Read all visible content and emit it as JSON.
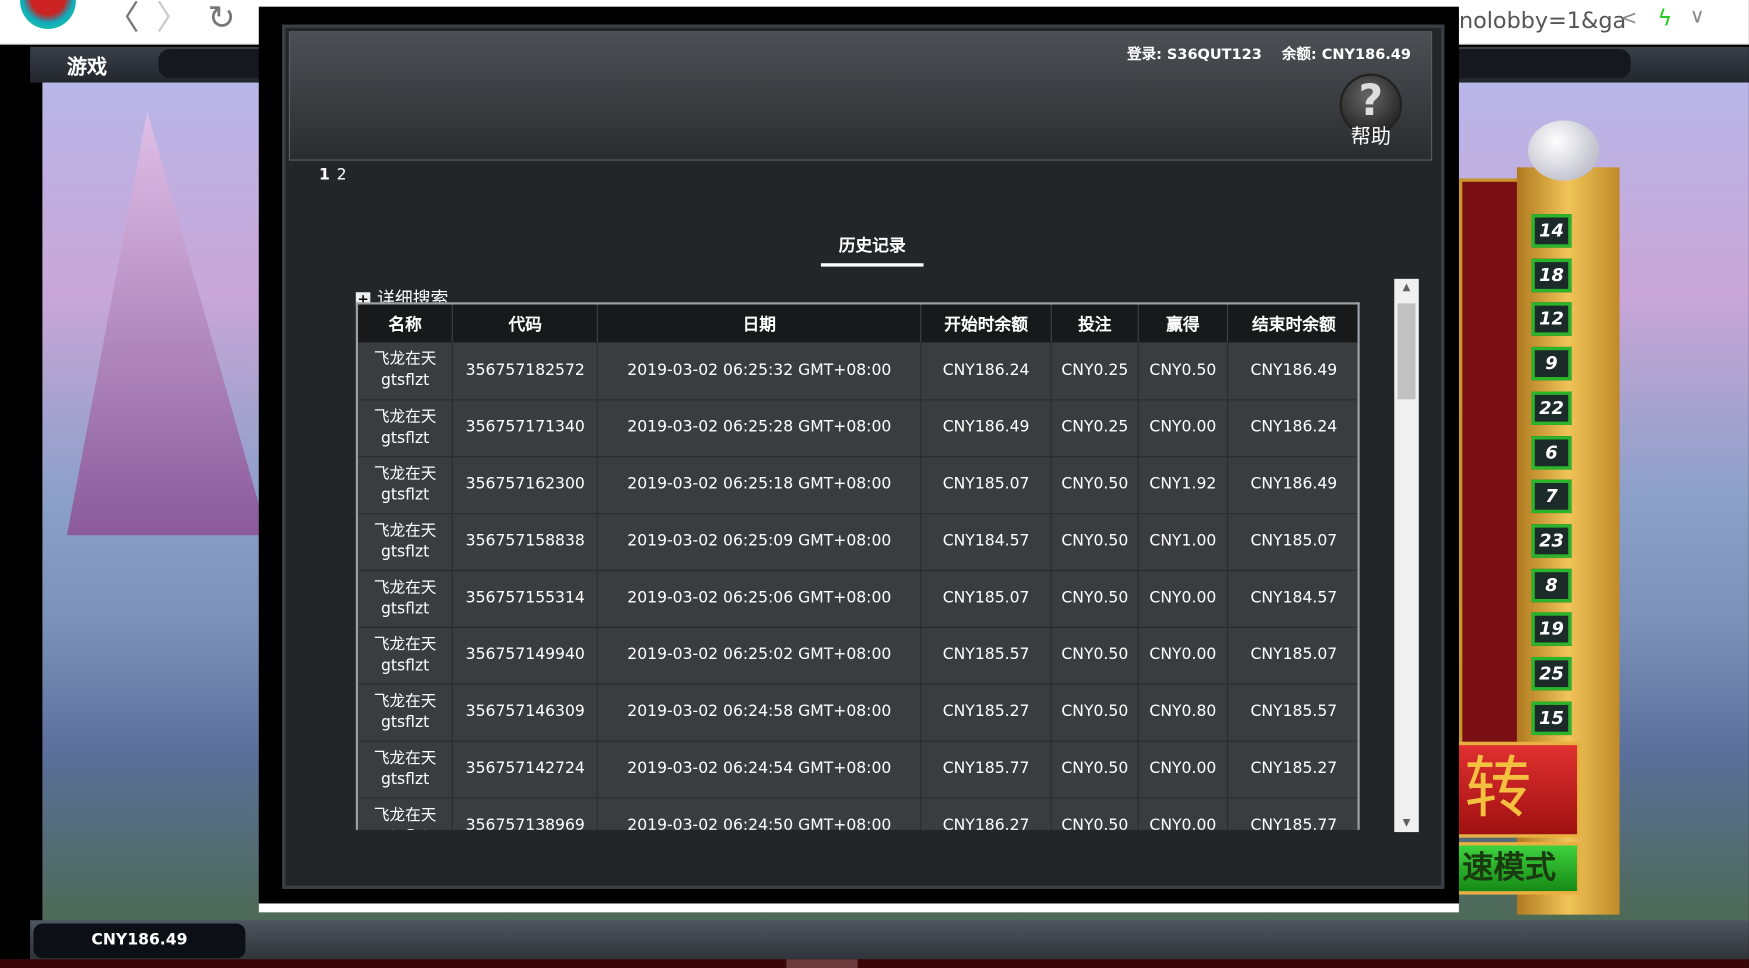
{
  "browser": {
    "url_fragment": "nolobby=1&ga",
    "icons": [
      "back-icon",
      "forward-icon",
      "refresh-icon",
      "share-icon",
      "bolt-icon",
      "chevron-down-icon"
    ]
  },
  "game": {
    "nav_title": "游戏",
    "reel_numbers": [
      "14",
      "18",
      "12",
      "9",
      "22",
      "6",
      "7",
      "23",
      "8",
      "19",
      "25",
      "15"
    ],
    "spin_label": "转",
    "turbo_label": "速模式",
    "balance": "CNY186.49"
  },
  "modal": {
    "login": "登录: S36QUT123",
    "balance": "余额: CNY186.49",
    "help_label": "帮助",
    "pages": [
      "1",
      "2"
    ],
    "tab": "历史记录",
    "search_toggle": "详细搜索",
    "columns": [
      "名称",
      "代码",
      "日期",
      "开始时余额",
      "投注",
      "赢得",
      "结束时余额"
    ],
    "rows": [
      [
        "飞龙在天\ngtsflzt",
        "356757182572",
        "2019-03-02 06:25:32 GMT+08:00",
        "CNY186.24",
        "CNY0.25",
        "CNY0.50",
        "CNY186.49"
      ],
      [
        "飞龙在天\ngtsflzt",
        "356757171340",
        "2019-03-02 06:25:28 GMT+08:00",
        "CNY186.49",
        "CNY0.25",
        "CNY0.00",
        "CNY186.24"
      ],
      [
        "飞龙在天\ngtsflzt",
        "356757162300",
        "2019-03-02 06:25:18 GMT+08:00",
        "CNY185.07",
        "CNY0.50",
        "CNY1.92",
        "CNY186.49"
      ],
      [
        "飞龙在天\ngtsflzt",
        "356757158838",
        "2019-03-02 06:25:09 GMT+08:00",
        "CNY184.57",
        "CNY0.50",
        "CNY1.00",
        "CNY185.07"
      ],
      [
        "飞龙在天\ngtsflzt",
        "356757155314",
        "2019-03-02 06:25:06 GMT+08:00",
        "CNY185.07",
        "CNY0.50",
        "CNY0.00",
        "CNY184.57"
      ],
      [
        "飞龙在天\ngtsflzt",
        "356757149940",
        "2019-03-02 06:25:02 GMT+08:00",
        "CNY185.57",
        "CNY0.50",
        "CNY0.00",
        "CNY185.07"
      ],
      [
        "飞龙在天\ngtsflzt",
        "356757146309",
        "2019-03-02 06:24:58 GMT+08:00",
        "CNY185.27",
        "CNY0.50",
        "CNY0.80",
        "CNY185.57"
      ],
      [
        "飞龙在天\ngtsflzt",
        "356757142724",
        "2019-03-02 06:24:54 GMT+08:00",
        "CNY185.77",
        "CNY0.50",
        "CNY0.00",
        "CNY185.27"
      ],
      [
        "飞龙在天\ngtsflzt",
        "356757138969",
        "2019-03-02 06:24:50 GMT+08:00",
        "CNY186.27",
        "CNY0.50",
        "CNY0.00",
        "CNY185.77"
      ]
    ]
  }
}
